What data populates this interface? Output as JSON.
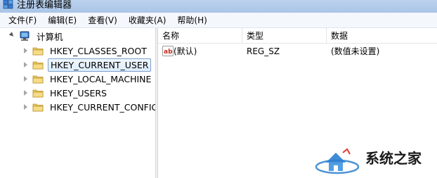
{
  "window": {
    "title": "注册表编辑器"
  },
  "menu": [
    "文件(F)",
    "编辑(E)",
    "查看(V)",
    "收藏夹(A)",
    "帮助(H)"
  ],
  "tree": {
    "root": "计算机",
    "children": [
      {
        "label": "HKEY_CLASSES_ROOT",
        "selected": false
      },
      {
        "label": "HKEY_CURRENT_USER",
        "selected": true
      },
      {
        "label": "HKEY_LOCAL_MACHINE",
        "selected": false
      },
      {
        "label": "HKEY_USERS",
        "selected": false
      },
      {
        "label": "HKEY_CURRENT_CONFIG",
        "selected": false
      }
    ]
  },
  "list": {
    "columns": [
      "名称",
      "类型",
      "数据"
    ],
    "rows": [
      {
        "name": "(默认)",
        "type": "REG_SZ",
        "data": "(数值未设置)"
      }
    ]
  },
  "watermark": {
    "title": "系统之家"
  },
  "colors": {
    "selection_border": "#7da2ce",
    "folder": "#e8c55a",
    "titlebar": "#bcd3ee"
  }
}
